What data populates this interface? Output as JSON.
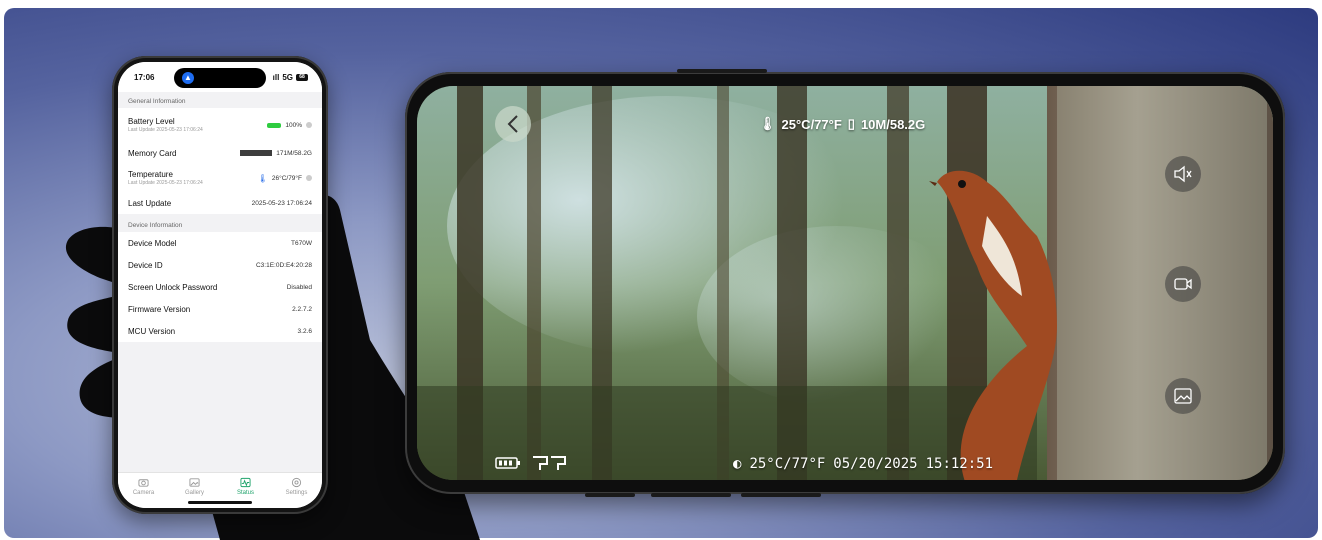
{
  "phone": {
    "statusbar": {
      "time": "17:06",
      "signal": "5G",
      "battery": "68"
    },
    "general_header": "General Information",
    "general": [
      {
        "label": "Battery Level",
        "sub": "Last Update 2025-05-23 17:06:24",
        "value": "100%"
      },
      {
        "label": "Memory Card",
        "sub": "",
        "value": "171M/58.2G"
      },
      {
        "label": "Temperature",
        "sub": "Last Update 2025-05-23 17:06:24",
        "value": "26°C/79°F"
      },
      {
        "label": "Last Update",
        "sub": "",
        "value": "2025-05-23 17:06:24"
      }
    ],
    "device_header": "Device Information",
    "device": [
      {
        "label": "Device Model",
        "value": "T670W"
      },
      {
        "label": "Device ID",
        "value": "C3:1E:0D:E4:20:28"
      },
      {
        "label": "Screen Unlock Password",
        "value": "Disabled"
      },
      {
        "label": "Firmware Version",
        "value": "2.2.7.2"
      },
      {
        "label": "MCU Version",
        "value": "3.2.6"
      }
    ],
    "tabs": [
      {
        "label": "Camera",
        "icon": "camera-icon"
      },
      {
        "label": "Gallery",
        "icon": "gallery-icon"
      },
      {
        "label": "Status",
        "icon": "status-icon",
        "active": true
      },
      {
        "label": "Settings",
        "icon": "settings-icon"
      }
    ],
    "active_color": "#1fa36b"
  },
  "camera_view": {
    "temperature": "25°C/77°F",
    "storage": "10M/58.2G",
    "bottom_temperature": "25°C/77°F",
    "date": "05/20/2025",
    "time": "15:12:51",
    "controls": [
      {
        "name": "mute",
        "icon": "speaker-mute-icon"
      },
      {
        "name": "record",
        "icon": "video-record-icon"
      },
      {
        "name": "photo",
        "icon": "image-icon"
      }
    ]
  }
}
